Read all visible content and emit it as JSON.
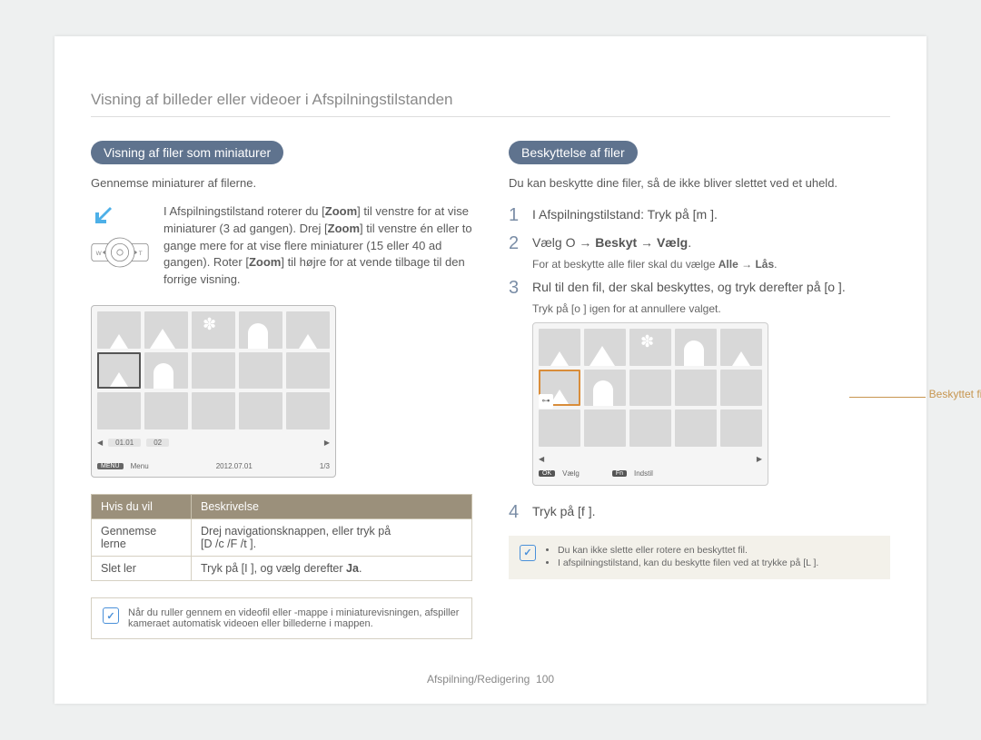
{
  "title": "Visning af billeder eller videoer i Afspilningstilstanden",
  "left": {
    "pill": "Visning af filer som miniaturer",
    "intro": "Gennemse miniaturer af filerne.",
    "zoom_text_1": "I Afspilningstilstand roterer du [",
    "zoom_bold_1": "Zoom",
    "zoom_text_2": "] til venstre for at vise miniaturer (3 ad gangen). Drej [",
    "zoom_bold_2": "Zoom",
    "zoom_text_3": "] til venstre én eller to gange mere for at vise flere miniaturer (15 eller 40 ad gangen). Roter [",
    "zoom_bold_3": "Zoom",
    "zoom_text_4": "] til højre for at vende tilbage til den forrige visning.",
    "thumb_bar": {
      "tab1": "01.01",
      "tab2": "02",
      "menu": "Menu",
      "date": "2012.07.01",
      "page": "1/3"
    },
    "table": {
      "h1": "Hvis du vil",
      "h2": "Beskrivelse",
      "r1c1": "Gennemse lerne",
      "r1c2a": "Drej navigationsknappen, eller tryk på",
      "r1c2b": "[D    /c   /F  /t     ].",
      "r2c1": "Slet ler",
      "r2c2a": "Tryk på [I    ], og vælg derefter ",
      "r2c2b": "Ja"
    },
    "note": "Når du ruller gennem en videofil eller -mappe i miniaturevisningen, afspiller kameraet automatisk videoen eller billederne i mappen."
  },
  "right": {
    "pill": "Beskyttelse af filer",
    "intro": "Du kan beskytte dine filer, så de ikke bliver slettet ved et uheld.",
    "s1": "I Afspilningstilstand: Tryk på [m       ].",
    "s2a": "Vælg O      → ",
    "s2b": "Beskyt",
    "s2c": " → ",
    "s2d": "Vælg",
    "s2e": ".",
    "s2sub_a": "For at beskytte alle filer skal du vælge ",
    "s2sub_b": "Alle",
    "s2sub_c": " → ",
    "s2sub_d": "Lås",
    "s2sub_e": ".",
    "s3": "Rul til den fil, der skal beskyttes, og tryk derefter på [o      ].",
    "s3sub": "Tryk på [o      ] igen for at annullere valget.",
    "callout": "Beskyttet fil",
    "grid_bar": {
      "ok": "Vælg",
      "fn": "Indstil"
    },
    "s4": "Tryk på [f     ].",
    "note_li1": "Du kan ikke slette eller rotere en beskyttet fil.",
    "note_li2": "I afspilningstilstand, kan du beskytte filen ved at trykke på [L          ]."
  },
  "footer": {
    "section": "Afspilning/Redigering",
    "page": "100"
  }
}
